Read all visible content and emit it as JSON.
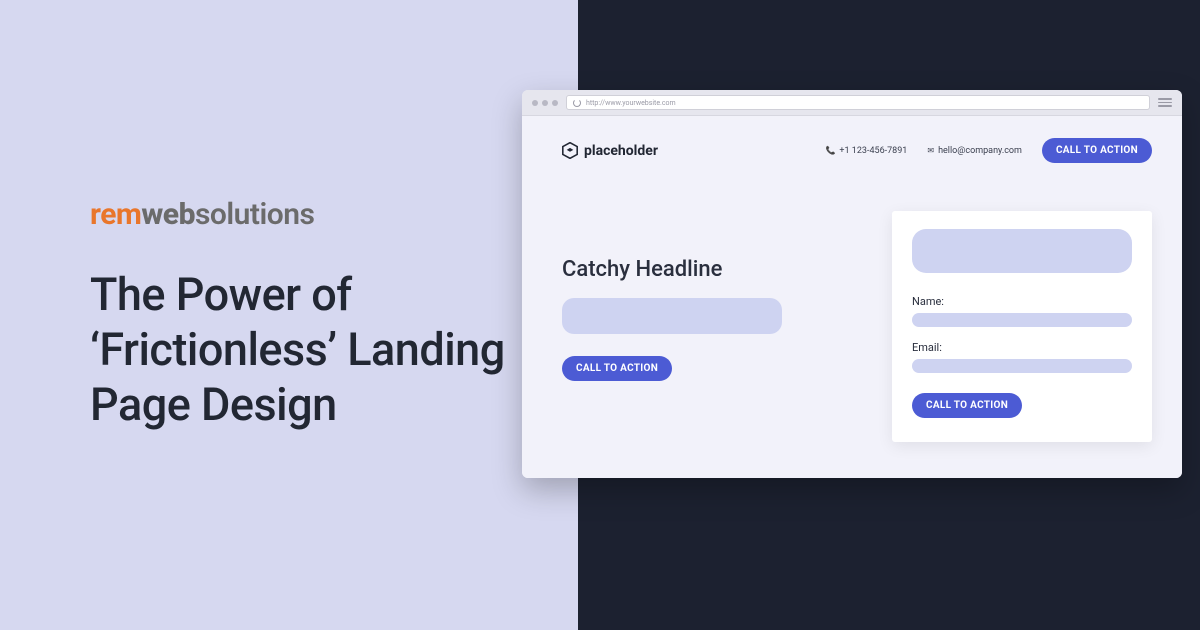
{
  "logo": {
    "part1": "rem",
    "part2": "web",
    "part3": "solutions"
  },
  "headline": "The Power of ‘Frictionless’ Landing Page Design",
  "browser": {
    "url": "http://www.yourwebsite.com"
  },
  "mockup": {
    "brand": "placeholder",
    "phone": "+1 123-456-7891",
    "email": "hello@company.com",
    "cta_top": "CALL TO ACTION",
    "catchy": "Catchy Headline",
    "cta_left": "CALL TO ACTION",
    "form": {
      "name_label": "Name:",
      "email_label": "Email:",
      "cta": "CALL TO ACTION"
    }
  }
}
